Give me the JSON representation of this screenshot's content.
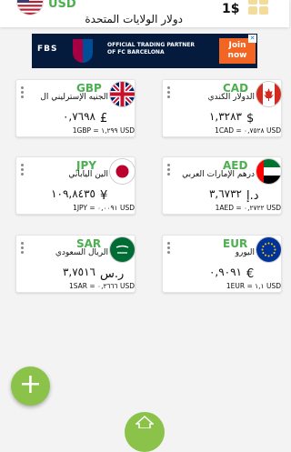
{
  "base": {
    "code": "USD",
    "name": "دولار الولايات المتحدة",
    "amount": "1$",
    "flag_icon": "us-flag-icon"
  },
  "ad": {
    "brand": "FBS",
    "line1": "OFFICIAL TRADING PARTNER",
    "line2": "OF FC BARCELONA",
    "cta": "Join now"
  },
  "cards": [
    {
      "code": "GBP",
      "name": "الجنيه الإسترليني ال",
      "symbol": "£",
      "value": "٠,٧٦٩٨",
      "rate": "1GBP = ١,٢٩٩ USD",
      "flag_icon": "uk-flag-icon"
    },
    {
      "code": "CAD",
      "name": "الدولار الكندي",
      "symbol": "$",
      "value": "١,٣٢٨٣",
      "rate": "1CAD = ٠,٧٥٢٨ USD",
      "flag_icon": "canada-flag-icon"
    },
    {
      "code": "JPY",
      "name": "الين الياباني",
      "symbol": "¥",
      "value": "١٠٩,٨٤٣٥",
      "rate": "1JPY = ٠,٠٠٩١ USD",
      "flag_icon": "japan-flag-icon"
    },
    {
      "code": "AED",
      "name": "درهم الإمارات العربي",
      "symbol": "د.إ",
      "value": "٣,٦٧٣٢",
      "rate": "1AED = ٠,٢٧٢٢ USD",
      "flag_icon": "uae-flag-icon"
    },
    {
      "code": "SAR",
      "name": "الريال السعودي",
      "symbol": "ر.س",
      "value": "٣,٧٥١٦",
      "rate": "1SAR = ٠,٢٦٦٦ USD",
      "flag_icon": "saudi-flag-icon"
    },
    {
      "code": "EUR",
      "name": "اليورو",
      "symbol": "€",
      "value": "٠,٩٠٩١",
      "rate": "1EUR = ١,١ USD",
      "flag_icon": "eu-flag-icon"
    }
  ],
  "fab": {
    "label": "+"
  },
  "colors": {
    "accent": "#4caf50",
    "fab": "#8bc34a"
  }
}
